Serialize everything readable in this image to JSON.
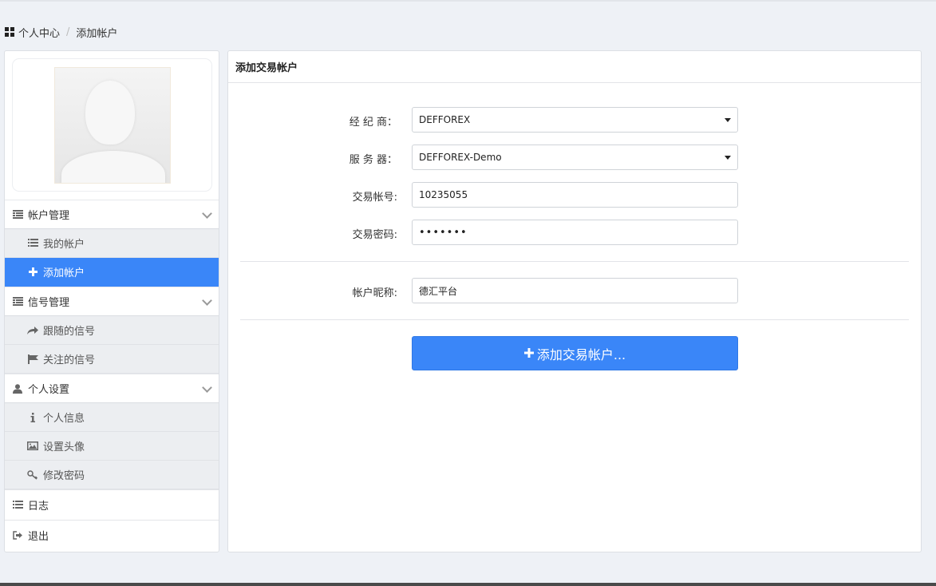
{
  "breadcrumb": {
    "home": "个人中心",
    "separator": "/",
    "current": "添加帐户"
  },
  "sidebar": {
    "groups": [
      {
        "label": "帐户管理",
        "icon": "list-alt-icon",
        "items": [
          {
            "label": "我的帐户",
            "icon": "list-icon"
          },
          {
            "label": "添加帐户",
            "icon": "plus-icon",
            "active": true
          }
        ]
      },
      {
        "label": "信号管理",
        "icon": "list-alt-icon",
        "items": [
          {
            "label": "跟随的信号",
            "icon": "share-icon"
          },
          {
            "label": "关注的信号",
            "icon": "flag-icon"
          }
        ]
      },
      {
        "label": "个人设置",
        "icon": "user-icon",
        "items": [
          {
            "label": "个人信息",
            "icon": "info-icon"
          },
          {
            "label": "设置头像",
            "icon": "picture-icon"
          },
          {
            "label": "修改密码",
            "icon": "key-icon"
          }
        ]
      }
    ],
    "log": {
      "label": "日志",
      "icon": "list-icon"
    },
    "logout": {
      "label": "退出",
      "icon": "logout-icon"
    },
    "active_color": "#3a86f8"
  },
  "form": {
    "title": "添加交易帐户",
    "broker_label": "经 纪 商：",
    "broker_value": "DEFFOREX",
    "server_label": "服 务 器：",
    "server_value": "DEFFOREX-Demo",
    "account_label": "交易帐号:",
    "account_value": "10235055",
    "password_label": "交易密码:",
    "password_value": "•••••••",
    "nickname_label": "帐户昵称:",
    "nickname_value": "德汇平台",
    "submit_label": "添加交易帐户..."
  }
}
